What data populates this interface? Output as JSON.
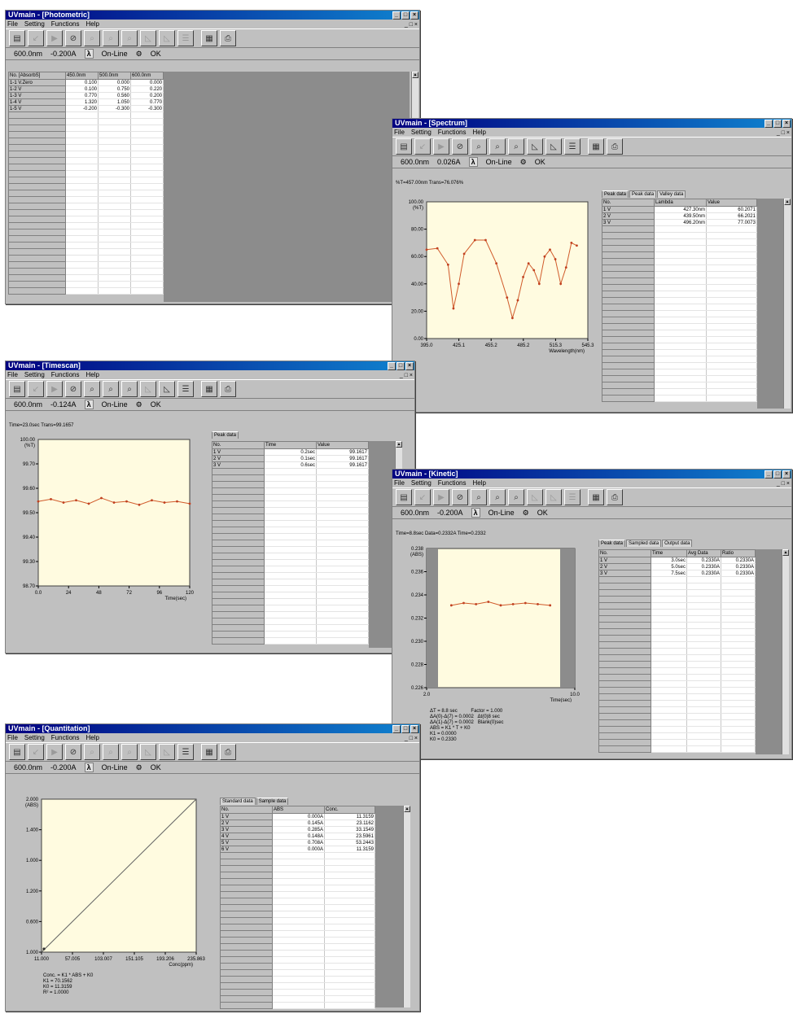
{
  "common": {
    "app": "UVmain",
    "menu": [
      "File",
      "Setting",
      "Functions",
      "Help"
    ],
    "status": {
      "lambda_icon": "λ",
      "online": "On-Line",
      "ok": "OK"
    }
  },
  "photometric": {
    "title": "UVmain - [Photometric]",
    "wavelength": "600.0nm",
    "absorbance": "-0.200A",
    "columns": [
      "No.  [AbsorbS]",
      "450.0nm",
      "500.0nm",
      "600.0nm"
    ],
    "rows": [
      [
        "1-1 V.Zero",
        "0.100",
        "0.000",
        "0.000"
      ],
      [
        "1-2 V",
        "0.100",
        "0.750",
        "0.220"
      ],
      [
        "1-3 V",
        "0.770",
        "0.560",
        "0.200"
      ],
      [
        "1-4 V",
        "1.320",
        "1.050",
        "0.770"
      ],
      [
        "1-5 V",
        "-0.200",
        "-0.300",
        "-0.300"
      ]
    ]
  },
  "spectrum": {
    "title": "UVmain - [Spectrum]",
    "wavelength": "600.0nm",
    "absorbance": "0.026A",
    "panel_header": "%T=457.00nm  Trans=76.076%",
    "tabs": [
      "Peak data",
      "Peak data",
      "Valley data"
    ],
    "columns": [
      "No.",
      "Lambda",
      "Value"
    ],
    "rows": [
      [
        "1 V",
        "427.30nm",
        "60.2071"
      ],
      [
        "2 V",
        "439.50nm",
        "66.2021"
      ],
      [
        "3 V",
        "496.20nm",
        "77.0073"
      ]
    ],
    "y_top": "100.00",
    "y_unit": "(%T)",
    "y_ticks": [
      "80.00",
      "60.00",
      "40.00",
      "20.00",
      "0.00"
    ],
    "x_ticks": [
      "395.0",
      "425.1",
      "455.2",
      "485.2",
      "515.3",
      "545.3"
    ],
    "x_label": "Wavelength(nm)"
  },
  "timescan": {
    "title": "UVmain - [Timescan]",
    "wavelength": "600.0nm",
    "absorbance": "-0.124A",
    "panel_header": "Time=23.0sec  Trans=99.1657",
    "tabs": [
      "Peak data"
    ],
    "columns": [
      "No.",
      "Time",
      "Value"
    ],
    "rows": [
      [
        "1 V",
        "0.2sec",
        "99.1617"
      ],
      [
        "2 V",
        "0.1sec",
        "99.1617"
      ],
      [
        "3 V",
        "0.6sec",
        "99.1617"
      ]
    ],
    "y_top": "100.00",
    "y_unit": "(%T)",
    "y_ticks": [
      "99.70",
      "99.60",
      "99.50",
      "99.40",
      "99.30",
      "98.70"
    ],
    "x_ticks": [
      "0.0",
      "24",
      "48",
      "72",
      "96",
      "120"
    ],
    "x_label": "Time(sec)"
  },
  "kinetic": {
    "title": "UVmain - [Kinetic]",
    "wavelength": "600.0nm",
    "absorbance": "-0.200A",
    "panel_header": "Time=8.8sec  Data=0.2332A  Time=0.2332",
    "tabs": [
      "Peak data",
      "Sampled data",
      "Output data"
    ],
    "columns": [
      "No.",
      "Time",
      "Avg Data",
      "Ratio"
    ],
    "rows": [
      [
        "1 V",
        "3.0sec",
        "0.2330A",
        "0.2330A"
      ],
      [
        "2 V",
        "5.0sec",
        "0.2330A",
        "0.2330A"
      ],
      [
        "3 V",
        "7.5sec",
        "0.2330A",
        "0.2330A"
      ]
    ],
    "y_top": "0.238",
    "y_unit": "(ABS)",
    "y_ticks": [
      "0.236",
      "0.234",
      "0.232",
      "0.230",
      "0.228",
      "0.226"
    ],
    "x_ticks": [
      "2.0",
      "10.0"
    ],
    "x_label": "Time(sec)",
    "notes": "ΔT = 8.8 sec          Factor = 1.000\nΔA(0)-Δ(7) = 0.0002   Δt(0)8 sec\nΔA(1)-Δ(7) = 0.0002   Blank(0)sec\nABS = K1 * T + K0\nK1 = 0.0000\nK0 = 0.2330"
  },
  "quantitation": {
    "title": "UVmain - [Quantitation]",
    "wavelength": "600.0nm",
    "absorbance": "-0.200A",
    "tabs": [
      "Standard data",
      "Sample data"
    ],
    "columns": [
      "No.",
      "ABS",
      "Conc."
    ],
    "rows": [
      [
        "1 V",
        "0.000A",
        "11.3159"
      ],
      [
        "2 V",
        "0.145A",
        "23.1162"
      ],
      [
        "3 V",
        "0.285A",
        "33.1549"
      ],
      [
        "4 V",
        "0.148A",
        "23.5961"
      ],
      [
        "5 V",
        "0.708A",
        "53.2443"
      ],
      [
        "6 V",
        "0.000A",
        "11.3159"
      ]
    ],
    "y_top": "2.000",
    "y_unit": "(ABS)",
    "y_ticks": [
      "1.400",
      "1.000",
      "1.200",
      "0.600",
      "1.000"
    ],
    "x_ticks": [
      "11.000",
      "57.005",
      "103.007",
      "151.105",
      "193.206",
      "235.863"
    ],
    "x_label": "Conc(ppm)",
    "notes": "Conc. = K1 * ABS + K0\nK1 = 70.1562\nK0 = 11.3159\nR² = 1.0000"
  },
  "chart_data": [
    {
      "type": "line",
      "title": "",
      "xlabel": "Wavelength(nm)",
      "ylabel": "(%T)",
      "xlim": [
        395.0,
        545.3
      ],
      "ylim": [
        0,
        100
      ],
      "x": [
        395,
        405,
        415,
        420,
        425,
        430,
        440,
        450,
        460,
        470,
        475,
        480,
        485,
        490,
        495,
        500,
        505,
        510,
        515,
        520,
        525,
        530,
        535
      ],
      "series": [
        {
          "values": [
            65,
            66,
            54,
            22,
            40,
            62,
            72,
            72,
            55,
            30,
            15,
            28,
            45,
            55,
            50,
            40,
            60,
            65,
            58,
            40,
            52,
            70,
            68
          ]
        }
      ]
    },
    {
      "type": "line",
      "title": "",
      "xlabel": "Time(sec)",
      "ylabel": "(%T)",
      "xlim": [
        0,
        120
      ],
      "ylim": [
        98.7,
        100.0
      ],
      "x": [
        0,
        10,
        20,
        30,
        40,
        50,
        60,
        70,
        80,
        90,
        100,
        110,
        120
      ],
      "series": [
        {
          "values": [
            99.45,
            99.47,
            99.44,
            99.46,
            99.43,
            99.48,
            99.44,
            99.45,
            99.42,
            99.46,
            99.44,
            99.45,
            99.43
          ]
        }
      ]
    },
    {
      "type": "line",
      "title": "",
      "xlabel": "Time(sec)",
      "ylabel": "(ABS)",
      "xlim": [
        0,
        12
      ],
      "ylim": [
        0.226,
        0.238
      ],
      "x": [
        2,
        3,
        4,
        5,
        6,
        7,
        8,
        9,
        10
      ],
      "series": [
        {
          "values": [
            0.2331,
            0.2333,
            0.2332,
            0.2334,
            0.2331,
            0.2332,
            0.2333,
            0.2332,
            0.2331
          ]
        }
      ]
    },
    {
      "type": "line",
      "title": "",
      "xlabel": "Conc(ppm)",
      "ylabel": "(ABS)",
      "xlim": [
        11.0,
        235.863
      ],
      "ylim": [
        0,
        2.0
      ],
      "x": [
        11.0,
        235.863
      ],
      "series": [
        {
          "values": [
            0.0,
            2.0
          ]
        }
      ]
    }
  ]
}
